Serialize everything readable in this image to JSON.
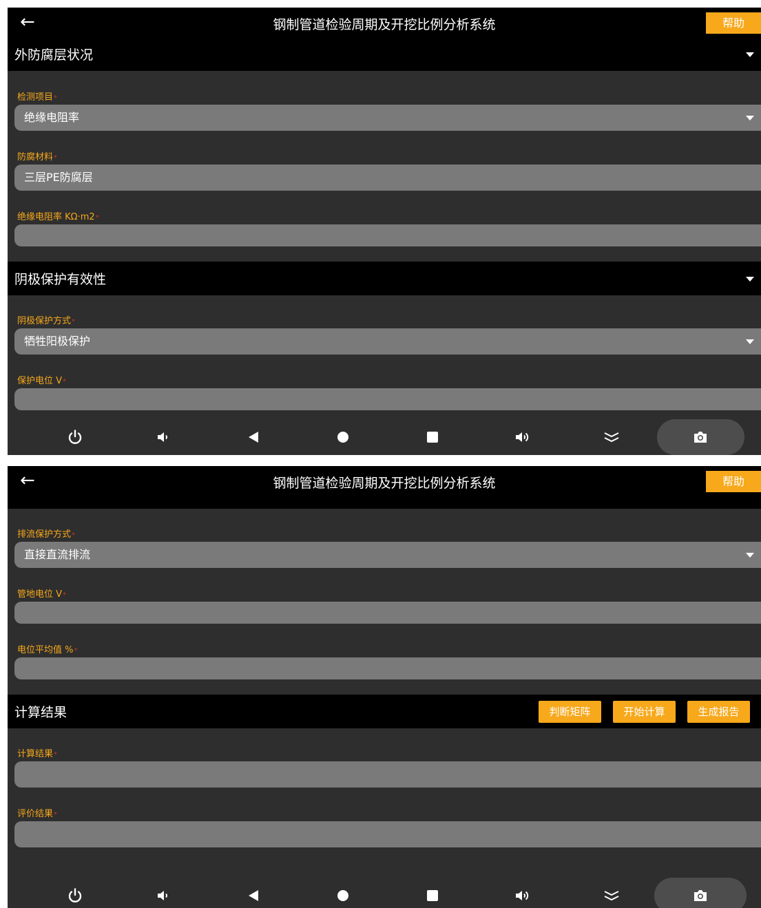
{
  "app": {
    "title": "钢制管道检验周期及开挖比例分析系统",
    "help_label": "帮助",
    "back_icon": "arrow-left-icon"
  },
  "colors": {
    "accent": "#f7a81b",
    "required": "#c0392b",
    "panel": "#2e2e2e",
    "field": "#7a7a7a",
    "header": "#000000"
  },
  "screen1": {
    "coating": {
      "title": "外防腐层状况",
      "detect_item": {
        "label": "检测项目",
        "value": "绝缘电阻率"
      },
      "material": {
        "label": "防腐材料",
        "value": "三层PE防腐层"
      },
      "resistivity": {
        "label": "绝缘电阻率 KΩ·m2",
        "value": ""
      }
    },
    "cathodic": {
      "title": "阴极保护有效性",
      "method": {
        "label": "阴极保护方式",
        "value": "牺牲阳极保护"
      },
      "potential": {
        "label": "保护电位 V",
        "value": ""
      }
    }
  },
  "screen2": {
    "drainage": {
      "method": {
        "label": "排流保护方式",
        "value": "直接直流排流"
      },
      "pipe_potential": {
        "label": "管地电位 V",
        "value": ""
      },
      "avg_potential": {
        "label": "电位平均值 %",
        "value": ""
      }
    },
    "results": {
      "title": "计算结果",
      "buttons": [
        "判断矩阵",
        "开始计算",
        "生成报告"
      ],
      "calc_result": {
        "label": "计算结果",
        "value": ""
      },
      "eval_result": {
        "label": "评价结果",
        "value": ""
      }
    }
  },
  "required_mark": "*",
  "navbar_icons": [
    "power-icon",
    "volume-down-icon",
    "back-triangle-icon",
    "home-circle-icon",
    "recents-square-icon",
    "volume-up-icon",
    "collapse-chevrons-icon",
    "camera-icon"
  ]
}
